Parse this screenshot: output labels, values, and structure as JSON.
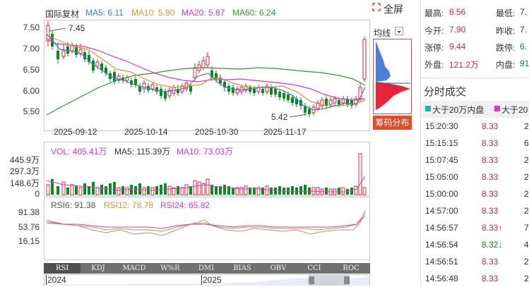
{
  "header": {
    "stock_name": "国际复材",
    "ma5": "MA5: 6.11",
    "ma10": "MA10: 5.90",
    "ma20": "MA20: 5.87",
    "ma60": "MA60: 6.24",
    "fullscreen": "全屏",
    "avg_line": "均线",
    "chip_btn": "筹码分布"
  },
  "price_axis": [
    "7.50",
    "7.00",
    "6.50",
    "6.00",
    "5.50"
  ],
  "annotations": {
    "high": "7.45",
    "low": "5.42"
  },
  "dates": [
    "2025-09-12",
    "2025-10-14",
    "2025-10-30",
    "2025-11-17"
  ],
  "vol_legend": {
    "vol": "VOL: 405.41万",
    "ma5": "MA5: 115.39万",
    "ma10": "MA10: 73.03万"
  },
  "vol_axis": [
    "445.9万",
    "297.3万",
    "148.6万",
    "0"
  ],
  "rsi_legend": {
    "rsi6": "RSI6: 91.38",
    "rsi12": "RSI12: 78.78",
    "rsi24": "RSI24: 65.82"
  },
  "rsi_axis": [
    "91.38",
    "53.76",
    "16.15"
  ],
  "indicator_tabs": [
    "RSI",
    "KDJ",
    "MACD",
    "W%R",
    "DMI",
    "BIAS",
    "OBV",
    "CCI",
    "ROC"
  ],
  "timeline": {
    "y2024": "2024",
    "y2025": "2025"
  },
  "quote": {
    "high_label": "最高:",
    "high_value": "8.56",
    "low_label": "最低:",
    "low_value": "7.",
    "open_label": "今开:",
    "open_value": "7.90",
    "prev_label": "昨收:",
    "prev_value": "7.",
    "limit_up_label": "涨停:",
    "limit_up_value": "9.44",
    "limit_down_label": "跌停:",
    "limit_down_value": "6.",
    "outer_label": "外盘:",
    "outer_value": "121.2万",
    "inner_label": "内盘:",
    "inner_value": "91"
  },
  "trades_title": "分时成交",
  "trades_legend": {
    "big_sell": "大于20万内盘",
    "big_buy": "大于20"
  },
  "trades": [
    {
      "time": "15:20:30",
      "price": "8.33",
      "vol": "2",
      "arrow": ""
    },
    {
      "time": "15:15:15",
      "price": "8.33",
      "vol": "6",
      "arrow": ""
    },
    {
      "time": "15:07:45",
      "price": "8.33",
      "vol": "2",
      "arrow": ""
    },
    {
      "time": "15:05:00",
      "price": "8.33",
      "vol": "2",
      "arrow": ""
    },
    {
      "time": "15:00:00",
      "price": "8.33",
      "vol": "2",
      "arrow": ""
    },
    {
      "time": "14:57:00",
      "price": "8.33",
      "vol": "2",
      "arrow": ""
    },
    {
      "time": "14:56:57",
      "price": "8.33",
      "vol": "7",
      "arrow": "↑"
    },
    {
      "time": "14:56:54",
      "price": "8.32",
      "vol": "4",
      "arrow": "↓"
    },
    {
      "time": "14:56:51",
      "price": "8.33",
      "vol": "2",
      "arrow": ""
    },
    {
      "time": "14:56:48",
      "price": "8.33",
      "vol": "2",
      "arrow": ""
    }
  ],
  "colors": {
    "up": "#e6243a",
    "down": "#0a8a22",
    "ma5": "#3f7fc2",
    "ma10": "#d8962a",
    "ma20": "#e035c6",
    "ma60": "#2b9a30"
  }
}
